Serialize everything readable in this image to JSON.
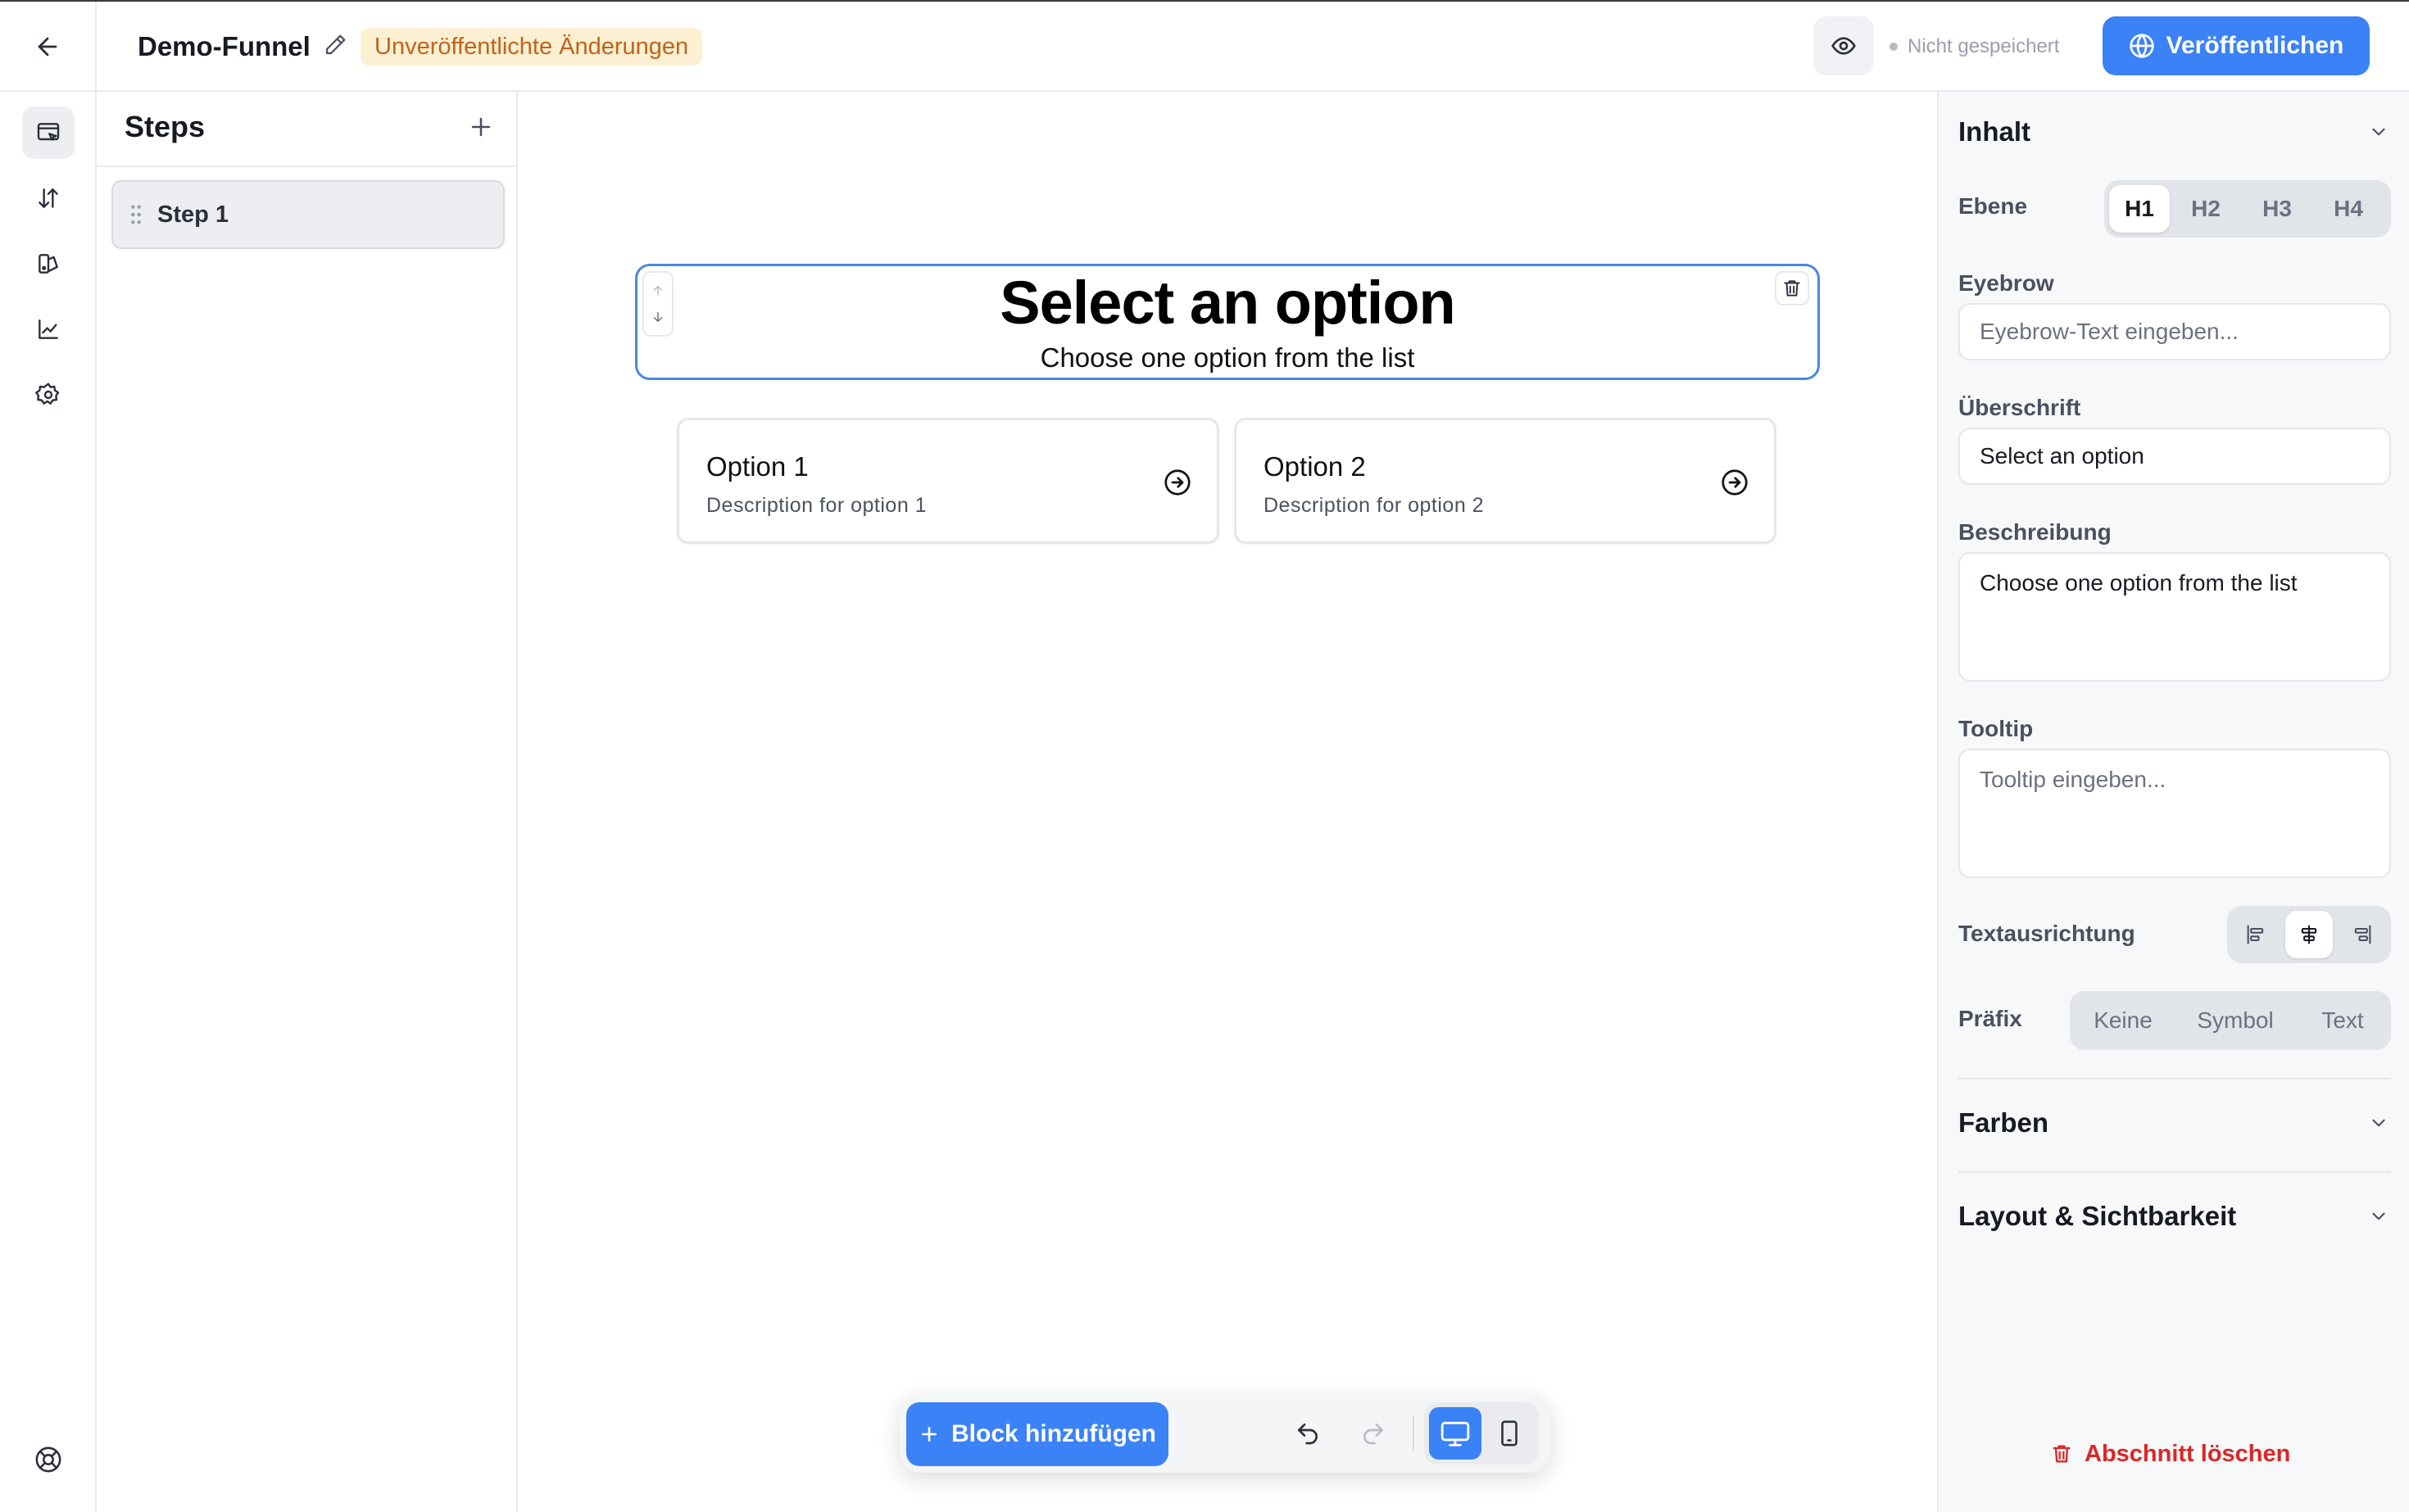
{
  "header": {
    "funnel_name": "Demo-Funnel",
    "unsaved_badge": "Unveröffentlichte Änderungen",
    "save_status": "Nicht gespeichert",
    "publish_label": "Veröffentlichen"
  },
  "rail": {
    "items": [
      "editor-icon",
      "sort-icon",
      "design-icon",
      "analytics-icon",
      "settings-icon"
    ],
    "bottom": "help-icon"
  },
  "steps": {
    "title": "Steps",
    "items": [
      {
        "label": "Step 1",
        "selected": true
      }
    ]
  },
  "canvas": {
    "heading": "Select an option",
    "description": "Choose one option from the list",
    "options": [
      {
        "title": "Option 1",
        "description": "Description for option 1"
      },
      {
        "title": "Option 2",
        "description": "Description for option 2"
      }
    ]
  },
  "toolbar": {
    "add_block_label": "Block hinzufügen"
  },
  "props": {
    "content_title": "Inhalt",
    "level_label": "Ebene",
    "levels": [
      "H1",
      "H2",
      "H3",
      "H4"
    ],
    "level_selected": "H1",
    "eyebrow_label": "Eyebrow",
    "eyebrow_placeholder": "Eyebrow-Text eingeben...",
    "heading_label": "Überschrift",
    "heading_value": "Select an option",
    "description_label": "Beschreibung",
    "description_value": "Choose one option from the list",
    "tooltip_label": "Tooltip",
    "tooltip_placeholder": "Tooltip eingeben...",
    "align_label": "Textausrichtung",
    "align_selected": "center",
    "prefix_label": "Präfix",
    "prefix_options": [
      "Keine",
      "Symbol",
      "Text"
    ],
    "colors_title": "Farben",
    "layout_title": "Layout & Sichtbarkeit",
    "delete_section_label": "Abschnitt löschen"
  },
  "colors": {
    "accent": "#3b82f6",
    "selection": "#4b86e8",
    "warning_bg": "#fdf0d2",
    "warning_text": "#c2621b",
    "danger": "#dc2626"
  }
}
